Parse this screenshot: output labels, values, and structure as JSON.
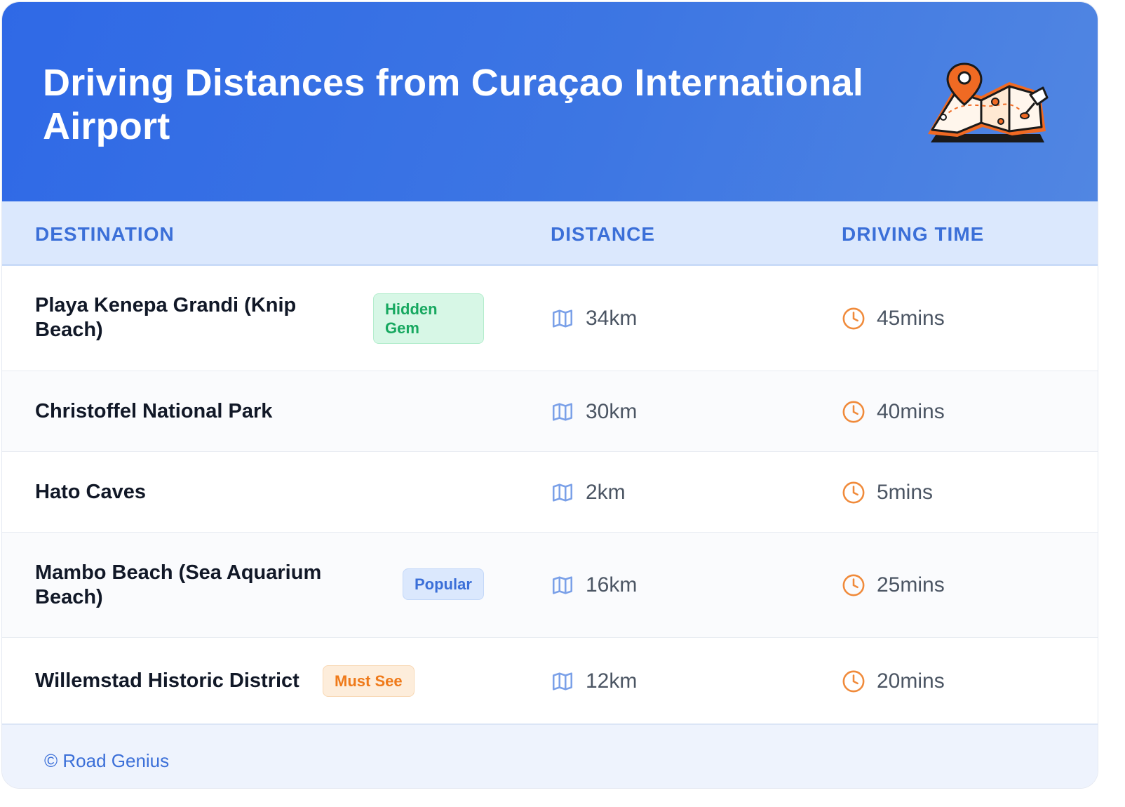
{
  "header": {
    "title": "Driving Distances from Curaçao International Airport",
    "illustration": "folded-map-with-location-pins-icon"
  },
  "table": {
    "columns": [
      "DESTINATION",
      "DISTANCE",
      "DRIVING TIME"
    ],
    "rows": [
      {
        "destination": "Playa Kenepa Grandi (Knip Beach)",
        "badge": "Hidden Gem",
        "badge_color": "green",
        "distance": "34km",
        "time": "45mins"
      },
      {
        "destination": "Christoffel National Park",
        "badge": "",
        "badge_color": "",
        "distance": "30km",
        "time": "40mins"
      },
      {
        "destination": "Hato Caves",
        "badge": "",
        "badge_color": "",
        "distance": "2km",
        "time": "5mins"
      },
      {
        "destination": "Mambo Beach (Sea Aquarium Beach)",
        "badge": "Popular",
        "badge_color": "blue",
        "distance": "16km",
        "time": "25mins"
      },
      {
        "destination": "Willemstad Historic District",
        "badge": "Must See",
        "badge_color": "orange",
        "distance": "12km",
        "time": "20mins"
      }
    ],
    "icons": {
      "distance": "map-icon",
      "time": "clock-icon"
    }
  },
  "footer": {
    "copyright": "© Road Genius"
  },
  "colors": {
    "header_start": "#2f69e6",
    "header_end": "#5186e2",
    "accent": "#3b6fd8",
    "clock_orange": "#f08a3a",
    "hidden_gem_green": "#17a860",
    "must_see_orange": "#ef7a1a"
  }
}
